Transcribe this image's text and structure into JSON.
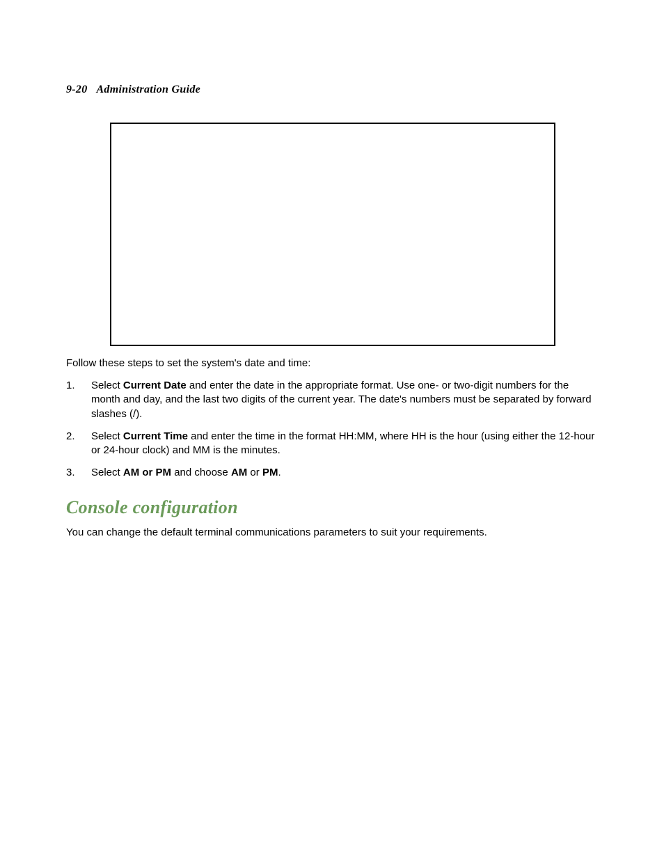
{
  "header": {
    "page_number": "9-20",
    "title": "Administration Guide"
  },
  "intro": "Follow these steps to set the system's date and time:",
  "steps": [
    {
      "prefix": "Select ",
      "bold1": "Current Date",
      "rest": " and enter the date in the appropriate format. Use one- or two-digit numbers for the month and day, and the last two digits of the current year. The date's numbers must be separated by forward slashes (/)."
    },
    {
      "prefix": "Select ",
      "bold1": "Current Time",
      "rest": " and enter the time in the format HH:MM, where HH is the hour (using either the 12-hour or 24-hour clock) and MM is the minutes."
    },
    {
      "prefix": "Select ",
      "bold1": "AM or PM",
      "mid": " and choose ",
      "bold2": "AM",
      "mid2": " or ",
      "bold3": "PM",
      "end": "."
    }
  ],
  "section": {
    "heading": "Console configuration",
    "body": "You can change the default terminal communications parameters to suit your requirements."
  }
}
